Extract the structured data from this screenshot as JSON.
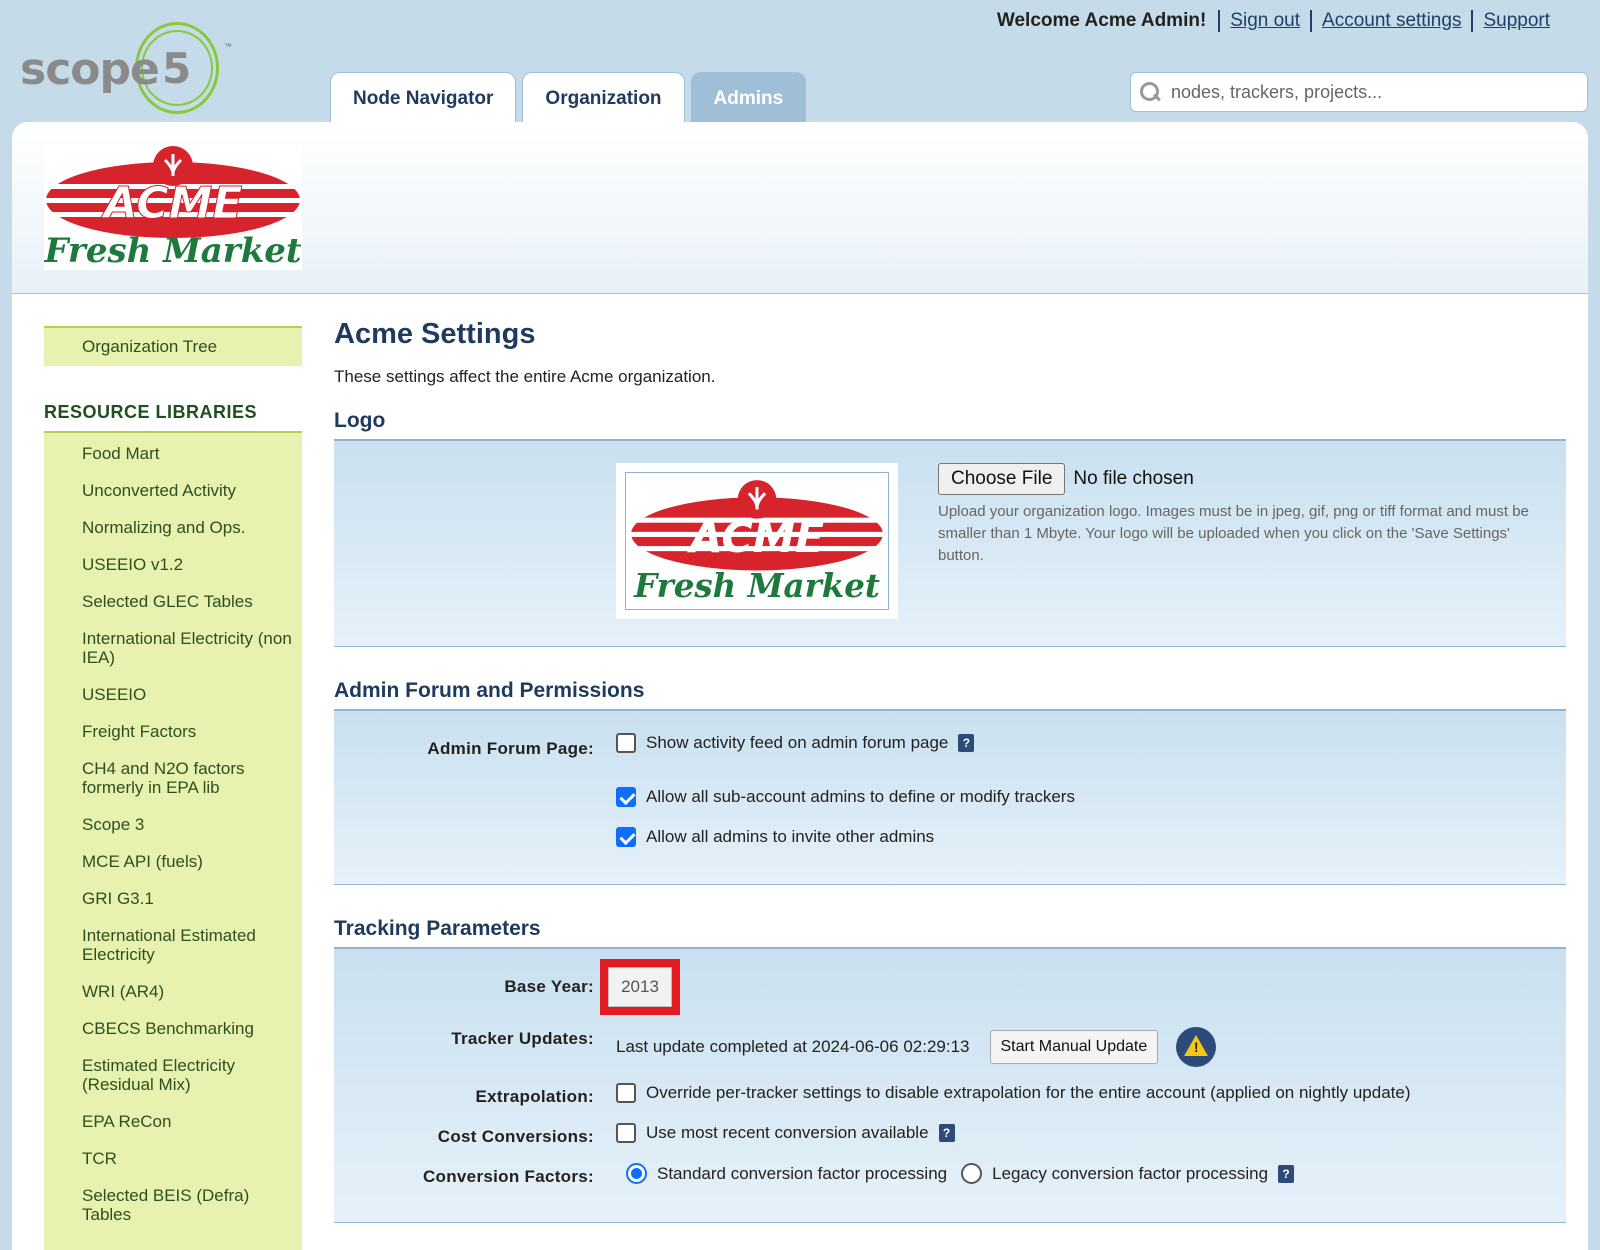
{
  "brand": {
    "word": "scope",
    "number": "5",
    "tm": "™"
  },
  "topnav": {
    "welcome": "Welcome Acme Admin!",
    "links": [
      "Sign out",
      "Account settings",
      "Support"
    ]
  },
  "tabs": [
    "Node Navigator",
    "Organization",
    "Admins"
  ],
  "search": {
    "placeholder": "nodes, trackers, projects..."
  },
  "org_logo": {
    "line1": "ACME",
    "line2": "Fresh Market"
  },
  "sidebar": {
    "top_item": "Organization Tree",
    "heading": "RESOURCE LIBRARIES",
    "items": [
      "Food Mart",
      "Unconverted Activity",
      "Normalizing and Ops.",
      "USEEIO v1.2",
      "Selected GLEC Tables",
      "International Electricity (non IEA)",
      "USEEIO",
      "Freight Factors",
      "CH4 and N2O factors formerly in EPA lib",
      "Scope 3",
      "MCE API (fuels)",
      "GRI G3.1",
      "International Estimated Electricity",
      "WRI (AR4)",
      "CBECS Benchmarking",
      "Estimated Electricity (Residual Mix)",
      "EPA ReCon",
      "TCR",
      "Selected BEIS (Defra) Tables"
    ]
  },
  "page": {
    "title": "Acme Settings",
    "description": "These settings affect the entire Acme organization."
  },
  "logo_section": {
    "title": "Logo",
    "file_button": "Choose File",
    "file_status": "No file chosen",
    "help": "Upload your organization logo. Images must be in jpeg, gif, png or tiff format and must be smaller than 1 Mbyte. Your logo will be uploaded when you click on the 'Save Settings' button."
  },
  "forum_section": {
    "title": "Admin Forum and Permissions",
    "label": "Admin Forum Page:",
    "options": [
      {
        "text": "Show activity feed on admin forum page",
        "checked": false
      },
      {
        "text": "Allow all sub-account admins to define or modify trackers",
        "checked": true
      },
      {
        "text": "Allow all admins to invite other admins",
        "checked": true
      }
    ],
    "help_mark": "?"
  },
  "tracking_section": {
    "title": "Tracking Parameters",
    "base_year_label": "Base Year:",
    "base_year": "2013",
    "tracker_updates_label": "Tracker Updates:",
    "last_update": "Last update completed at 2024-06-06 02:29:13",
    "update_button": "Start Manual Update",
    "warn_mark": "!",
    "extrapolation_label": "Extrapolation:",
    "extrapolation_text": "Override per-tracker settings to disable extrapolation for the entire account (applied on nightly update)",
    "cost_label": "Cost Conversions:",
    "cost_text": "Use most recent conversion available",
    "conversion_label": "Conversion Factors:",
    "conversion_options": [
      "Standard conversion factor processing",
      "Legacy conversion factor processing"
    ],
    "conversion_selected": "Standard conversion factor processing"
  },
  "colors": {
    "accent_navy": "#1e3a5e",
    "sidebar_green": "#e8f2b0",
    "acme_red": "#d7232b",
    "acme_green": "#1e7a3c",
    "highlight_red": "#e31b23",
    "checkbox_blue": "#0d6efd"
  }
}
